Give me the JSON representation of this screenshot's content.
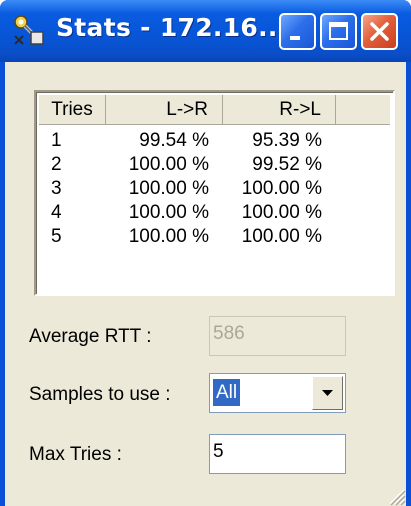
{
  "window": {
    "title": "Stats - 172.16...",
    "app_icon": "network-tool-icon",
    "controls": [
      "minimize-icon",
      "maximize-icon",
      "close-icon"
    ]
  },
  "table": {
    "columns": [
      "Tries",
      "L->R",
      "R->L"
    ],
    "rows": [
      [
        "1",
        "99.54 %",
        "95.39 %"
      ],
      [
        "2",
        "100.00 %",
        "99.52 %"
      ],
      [
        "3",
        "100.00 %",
        "100.00 %"
      ],
      [
        "4",
        "100.00 %",
        "100.00 %"
      ],
      [
        "5",
        "100.00 %",
        "100.00 %"
      ]
    ]
  },
  "average_rtt": {
    "label": "Average RTT :",
    "value": "586"
  },
  "samples": {
    "label": "Samples to use :",
    "value": "All"
  },
  "max_tries": {
    "label": "Max Tries :",
    "value": "5"
  },
  "colors": {
    "titlebar": "#0756d8",
    "selection": "#316ac5",
    "face": "#ece9d8"
  }
}
